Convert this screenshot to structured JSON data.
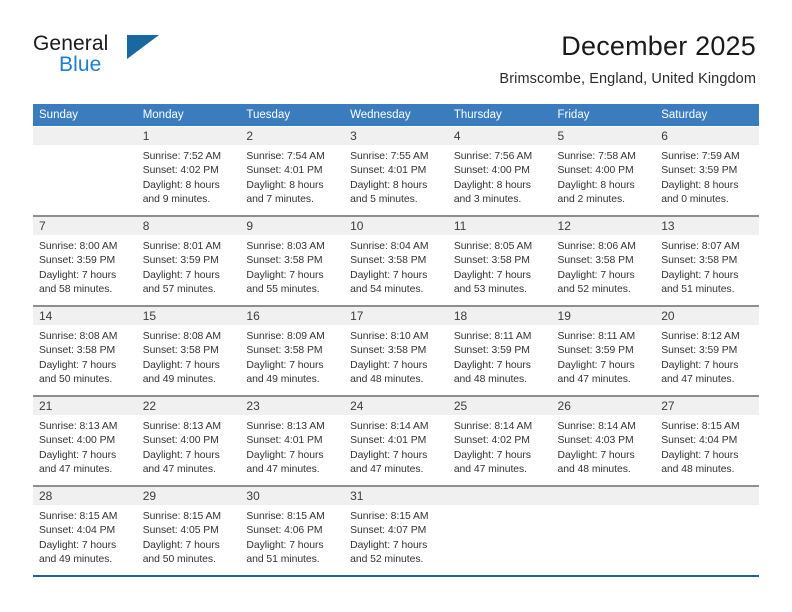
{
  "brand": {
    "name_part1": "General",
    "name_part2": "Blue",
    "triangle_color": "#19689f",
    "blue_color": "#1a7fd4"
  },
  "header": {
    "month_title": "December 2025",
    "location": "Brimscombe, England, United Kingdom"
  },
  "theme": {
    "header_row_bg": "#3b7cbf",
    "day_band_bg": "#f0f0f0",
    "row_separator": "#8e8e8e",
    "last_row_separator": "#1f5fa0",
    "text_color": "#333333"
  },
  "weekday_headers": [
    "Sunday",
    "Monday",
    "Tuesday",
    "Wednesday",
    "Thursday",
    "Friday",
    "Saturday"
  ],
  "weeks": [
    [
      {
        "day": "",
        "lines": []
      },
      {
        "day": "1",
        "lines": [
          "Sunrise: 7:52 AM",
          "Sunset: 4:02 PM",
          "Daylight: 8 hours",
          "and 9 minutes."
        ]
      },
      {
        "day": "2",
        "lines": [
          "Sunrise: 7:54 AM",
          "Sunset: 4:01 PM",
          "Daylight: 8 hours",
          "and 7 minutes."
        ]
      },
      {
        "day": "3",
        "lines": [
          "Sunrise: 7:55 AM",
          "Sunset: 4:01 PM",
          "Daylight: 8 hours",
          "and 5 minutes."
        ]
      },
      {
        "day": "4",
        "lines": [
          "Sunrise: 7:56 AM",
          "Sunset: 4:00 PM",
          "Daylight: 8 hours",
          "and 3 minutes."
        ]
      },
      {
        "day": "5",
        "lines": [
          "Sunrise: 7:58 AM",
          "Sunset: 4:00 PM",
          "Daylight: 8 hours",
          "and 2 minutes."
        ]
      },
      {
        "day": "6",
        "lines": [
          "Sunrise: 7:59 AM",
          "Sunset: 3:59 PM",
          "Daylight: 8 hours",
          "and 0 minutes."
        ]
      }
    ],
    [
      {
        "day": "7",
        "lines": [
          "Sunrise: 8:00 AM",
          "Sunset: 3:59 PM",
          "Daylight: 7 hours",
          "and 58 minutes."
        ]
      },
      {
        "day": "8",
        "lines": [
          "Sunrise: 8:01 AM",
          "Sunset: 3:59 PM",
          "Daylight: 7 hours",
          "and 57 minutes."
        ]
      },
      {
        "day": "9",
        "lines": [
          "Sunrise: 8:03 AM",
          "Sunset: 3:58 PM",
          "Daylight: 7 hours",
          "and 55 minutes."
        ]
      },
      {
        "day": "10",
        "lines": [
          "Sunrise: 8:04 AM",
          "Sunset: 3:58 PM",
          "Daylight: 7 hours",
          "and 54 minutes."
        ]
      },
      {
        "day": "11",
        "lines": [
          "Sunrise: 8:05 AM",
          "Sunset: 3:58 PM",
          "Daylight: 7 hours",
          "and 53 minutes."
        ]
      },
      {
        "day": "12",
        "lines": [
          "Sunrise: 8:06 AM",
          "Sunset: 3:58 PM",
          "Daylight: 7 hours",
          "and 52 minutes."
        ]
      },
      {
        "day": "13",
        "lines": [
          "Sunrise: 8:07 AM",
          "Sunset: 3:58 PM",
          "Daylight: 7 hours",
          "and 51 minutes."
        ]
      }
    ],
    [
      {
        "day": "14",
        "lines": [
          "Sunrise: 8:08 AM",
          "Sunset: 3:58 PM",
          "Daylight: 7 hours",
          "and 50 minutes."
        ]
      },
      {
        "day": "15",
        "lines": [
          "Sunrise: 8:08 AM",
          "Sunset: 3:58 PM",
          "Daylight: 7 hours",
          "and 49 minutes."
        ]
      },
      {
        "day": "16",
        "lines": [
          "Sunrise: 8:09 AM",
          "Sunset: 3:58 PM",
          "Daylight: 7 hours",
          "and 49 minutes."
        ]
      },
      {
        "day": "17",
        "lines": [
          "Sunrise: 8:10 AM",
          "Sunset: 3:58 PM",
          "Daylight: 7 hours",
          "and 48 minutes."
        ]
      },
      {
        "day": "18",
        "lines": [
          "Sunrise: 8:11 AM",
          "Sunset: 3:59 PM",
          "Daylight: 7 hours",
          "and 48 minutes."
        ]
      },
      {
        "day": "19",
        "lines": [
          "Sunrise: 8:11 AM",
          "Sunset: 3:59 PM",
          "Daylight: 7 hours",
          "and 47 minutes."
        ]
      },
      {
        "day": "20",
        "lines": [
          "Sunrise: 8:12 AM",
          "Sunset: 3:59 PM",
          "Daylight: 7 hours",
          "and 47 minutes."
        ]
      }
    ],
    [
      {
        "day": "21",
        "lines": [
          "Sunrise: 8:13 AM",
          "Sunset: 4:00 PM",
          "Daylight: 7 hours",
          "and 47 minutes."
        ]
      },
      {
        "day": "22",
        "lines": [
          "Sunrise: 8:13 AM",
          "Sunset: 4:00 PM",
          "Daylight: 7 hours",
          "and 47 minutes."
        ]
      },
      {
        "day": "23",
        "lines": [
          "Sunrise: 8:13 AM",
          "Sunset: 4:01 PM",
          "Daylight: 7 hours",
          "and 47 minutes."
        ]
      },
      {
        "day": "24",
        "lines": [
          "Sunrise: 8:14 AM",
          "Sunset: 4:01 PM",
          "Daylight: 7 hours",
          "and 47 minutes."
        ]
      },
      {
        "day": "25",
        "lines": [
          "Sunrise: 8:14 AM",
          "Sunset: 4:02 PM",
          "Daylight: 7 hours",
          "and 47 minutes."
        ]
      },
      {
        "day": "26",
        "lines": [
          "Sunrise: 8:14 AM",
          "Sunset: 4:03 PM",
          "Daylight: 7 hours",
          "and 48 minutes."
        ]
      },
      {
        "day": "27",
        "lines": [
          "Sunrise: 8:15 AM",
          "Sunset: 4:04 PM",
          "Daylight: 7 hours",
          "and 48 minutes."
        ]
      }
    ],
    [
      {
        "day": "28",
        "lines": [
          "Sunrise: 8:15 AM",
          "Sunset: 4:04 PM",
          "Daylight: 7 hours",
          "and 49 minutes."
        ]
      },
      {
        "day": "29",
        "lines": [
          "Sunrise: 8:15 AM",
          "Sunset: 4:05 PM",
          "Daylight: 7 hours",
          "and 50 minutes."
        ]
      },
      {
        "day": "30",
        "lines": [
          "Sunrise: 8:15 AM",
          "Sunset: 4:06 PM",
          "Daylight: 7 hours",
          "and 51 minutes."
        ]
      },
      {
        "day": "31",
        "lines": [
          "Sunrise: 8:15 AM",
          "Sunset: 4:07 PM",
          "Daylight: 7 hours",
          "and 52 minutes."
        ]
      },
      {
        "day": "",
        "lines": []
      },
      {
        "day": "",
        "lines": []
      },
      {
        "day": "",
        "lines": []
      }
    ]
  ]
}
